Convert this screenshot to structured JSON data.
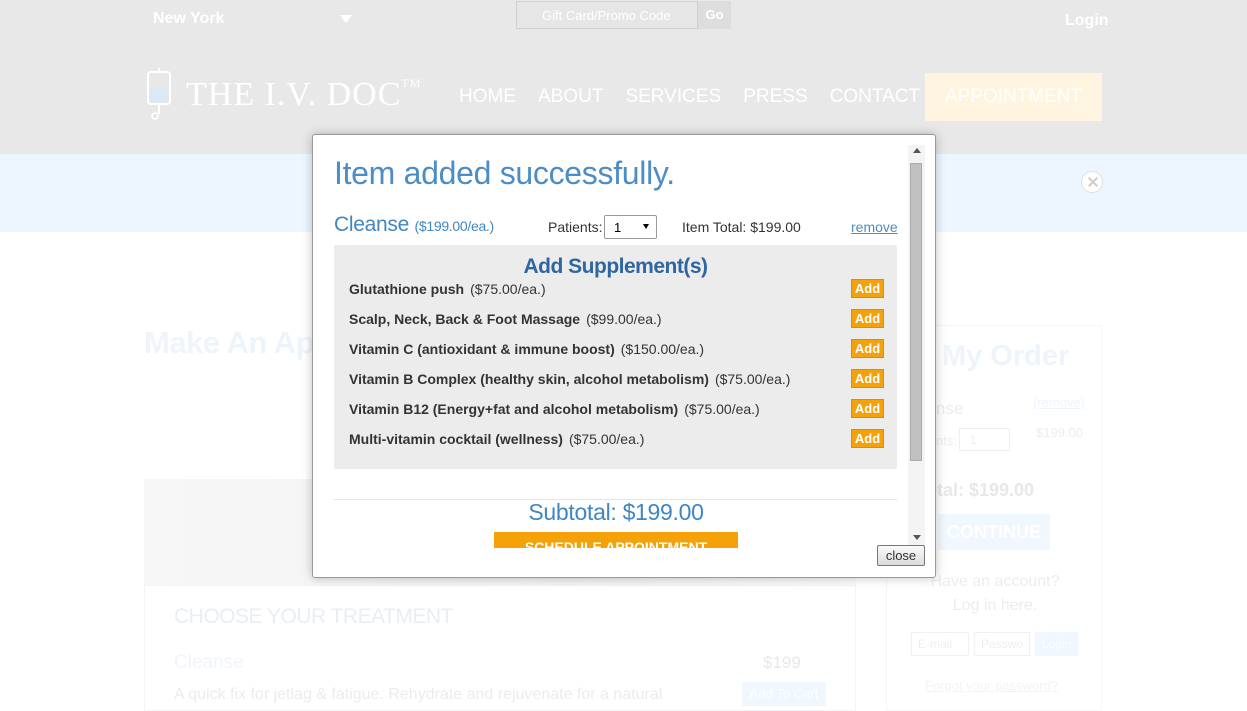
{
  "header": {
    "city": "New York",
    "promo_placeholder": "Gift Card/Promo Code",
    "promo_go": "Go",
    "login": "Login"
  },
  "brand": {
    "name": "THE I.V. DOC",
    "tm": "TM",
    "accent": "#4b8dc4",
    "button_color": "#f5a10a"
  },
  "nav": {
    "items": [
      "HOME",
      "ABOUT",
      "SERVICES",
      "PRESS",
      "CONTACT"
    ],
    "appointment": "APPOINTMENT"
  },
  "page": {
    "heading": "Make An Appo",
    "treatment": {
      "heading": "CHOOSE YOUR TREATMENT",
      "name": "Cleanse",
      "price": "$199",
      "description": "A quick fix for jetlag & fatigue. Rehydrate and rejuvenate for a natural",
      "add_to_cart": "Add To Cart"
    },
    "order": {
      "title": "My Order",
      "item_name": "nse",
      "remove": "(remove)",
      "patients_label": "nts:",
      "patients_value": "1",
      "item_price": "$199.00",
      "total": "otal: $199.00",
      "continue": "CONTINUE",
      "have_account_1": "Have an account?",
      "have_account_2": "Log in here.",
      "email_placeholder": "E-mail",
      "password_placeholder": "Passwo",
      "login": "Login",
      "forgot": "Forgot your password?"
    }
  },
  "modal": {
    "title": "Item added successfully.",
    "item_name": "Cleanse",
    "item_price": "($199.00/ea.)",
    "patients_label": "Patients:",
    "patients_value": "1",
    "item_total": "Item Total: $199.00",
    "remove": "remove",
    "supplements_title": "Add Supplement(s)",
    "add_label": "Add",
    "supplements": [
      {
        "name": "Glutathione push",
        "price": "($75.00/ea.)"
      },
      {
        "name": "Scalp, Neck, Back & Foot Massage",
        "price": "($99.00/ea.)"
      },
      {
        "name": "Vitamin C (antioxidant & immune boost)",
        "price": "($150.00/ea.)"
      },
      {
        "name": "Vitamin B Complex (healthy skin, alcohol metabolism)",
        "price": "($75.00/ea.)"
      },
      {
        "name": "Vitamin B12 (Energy+fat and alcohol metabolism)",
        "price": "($75.00/ea.)"
      },
      {
        "name": "Multi-vitamin cocktail (wellness)",
        "price": "($75.00/ea.)"
      }
    ],
    "subtotal": "Subtotal: $199.00",
    "schedule": "SCHEDULE APPOINTMENT",
    "close": "close"
  }
}
